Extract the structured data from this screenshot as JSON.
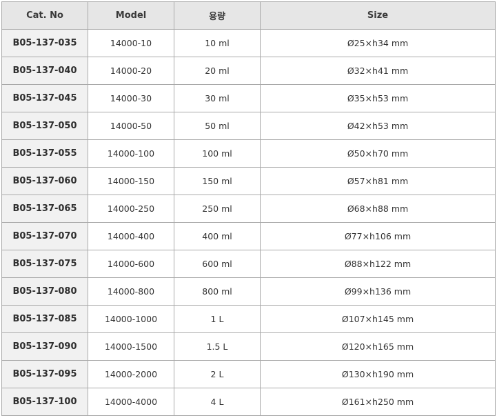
{
  "table": {
    "headers": [
      "Cat. No",
      "Model",
      "용량",
      "Size"
    ],
    "rows": [
      {
        "cat": "B05-137-035",
        "model": "14000-10",
        "capacity": "10 ml",
        "size": "Ø25×h34 mm"
      },
      {
        "cat": "B05-137-040",
        "model": "14000-20",
        "capacity": "20 ml",
        "size": "Ø32×h41 mm"
      },
      {
        "cat": "B05-137-045",
        "model": "14000-30",
        "capacity": "30 ml",
        "size": "Ø35×h53 mm"
      },
      {
        "cat": "B05-137-050",
        "model": "14000-50",
        "capacity": "50 ml",
        "size": "Ø42×h53 mm"
      },
      {
        "cat": "B05-137-055",
        "model": "14000-100",
        "capacity": "100 ml",
        "size": "Ø50×h70 mm"
      },
      {
        "cat": "B05-137-060",
        "model": "14000-150",
        "capacity": "150 ml",
        "size": "Ø57×h81 mm"
      },
      {
        "cat": "B05-137-065",
        "model": "14000-250",
        "capacity": "250 ml",
        "size": "Ø68×h88 mm"
      },
      {
        "cat": "B05-137-070",
        "model": "14000-400",
        "capacity": "400 ml",
        "size": "Ø77×h106 mm"
      },
      {
        "cat": "B05-137-075",
        "model": "14000-600",
        "capacity": "600 ml",
        "size": "Ø88×h122 mm"
      },
      {
        "cat": "B05-137-080",
        "model": "14000-800",
        "capacity": "800 ml",
        "size": "Ø99×h136 mm"
      },
      {
        "cat": "B05-137-085",
        "model": "14000-1000",
        "capacity": "1 L",
        "size": "Ø107×h145 mm"
      },
      {
        "cat": "B05-137-090",
        "model": "14000-1500",
        "capacity": "1.5 L",
        "size": "Ø120×h165 mm"
      },
      {
        "cat": "B05-137-095",
        "model": "14000-2000",
        "capacity": "2 L",
        "size": "Ø130×h190 mm"
      },
      {
        "cat": "B05-137-100",
        "model": "14000-4000",
        "capacity": "4 L",
        "size": "Ø161×h250 mm"
      }
    ]
  }
}
